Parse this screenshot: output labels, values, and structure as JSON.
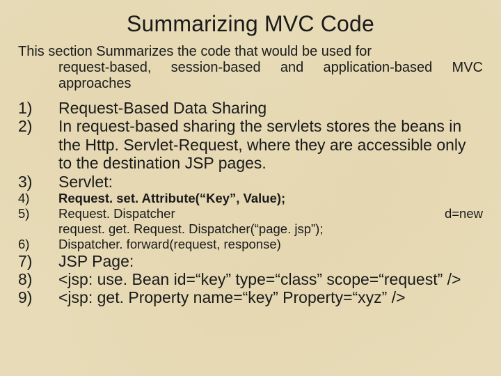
{
  "title": "Summarizing MVC Code",
  "intro_line1": "This section Summarizes the code that would be used for",
  "intro_rest": "request-based, session-based and application-based MVC approaches",
  "items": {
    "n1": "1)",
    "t1": "Request-Based Data Sharing",
    "n2": "2)",
    "t2": "In request-based sharing the servlets stores the beans in the Http. Servlet-Request, where they are accessible only to the destination JSP pages.",
    "n3": "3)",
    "t3": "Servlet:",
    "n4": "4)",
    "t4": "Request. set. Attribute(“Key”, Value);",
    "n5": "5)",
    "t5a": "Request. Dispatcher",
    "t5b": "d=new",
    "t5c": "request. get. Request. Dispatcher(“page. jsp”);",
    "n6": "6)",
    "t6": "Dispatcher. forward(request, response)",
    "n7": "7)",
    "t7": "JSP Page:",
    "n8": "8)",
    "t8": "<jsp: use. Bean id=“key” type=“class” scope=“request” />",
    "n9": "9)",
    "t9": "<jsp: get. Property name=“key” Property=“xyz” />"
  }
}
